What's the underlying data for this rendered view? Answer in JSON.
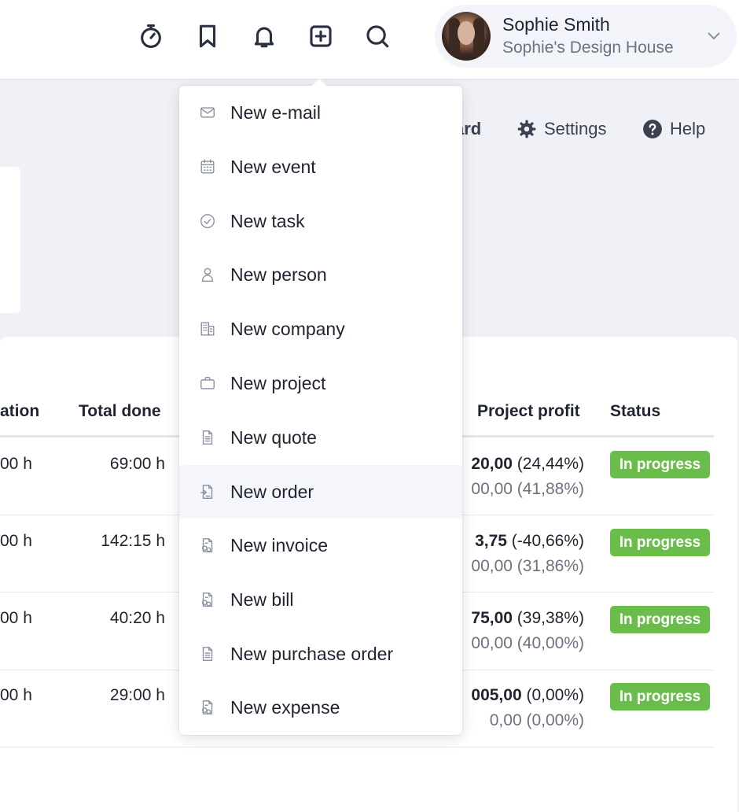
{
  "topbar": {
    "icons": [
      "stopwatch-icon",
      "bookmark-icon",
      "bell-icon",
      "plus-square-icon",
      "search-icon"
    ],
    "user": {
      "name": "Sophie Smith",
      "company": "Sophie's Design House"
    }
  },
  "subnav": {
    "partial_label": "ard",
    "settings_label": "Settings",
    "help_label": "Help"
  },
  "table": {
    "headers": {
      "duration_partial": "ation",
      "total_done": "Total done",
      "project_profit": "Project profit",
      "status": "Status"
    },
    "rows": [
      {
        "duration": "00 h",
        "total_done": "69:00 h",
        "profit_main": "20,00",
        "profit_main_pct": " (24,44%)",
        "profit_sub": "00,00 (41,88%)",
        "status": "In progress"
      },
      {
        "duration": "00 h",
        "total_done": "142:15 h",
        "profit_main": "3,75",
        "profit_main_pct": " (-40,66%)",
        "profit_sub": "00,00 (31,86%)",
        "status": "In progress"
      },
      {
        "duration": "00 h",
        "total_done": "40:20 h",
        "profit_main": "75,00",
        "profit_main_pct": " (39,38%)",
        "profit_sub": "00,00 (40,00%)",
        "status": "In progress"
      },
      {
        "duration": "00 h",
        "total_done": "29:00 h",
        "profit_main": "005,00",
        "profit_main_pct": " (0,00%)",
        "profit_sub": "0,00 (0,00%)",
        "status": "In progress"
      }
    ]
  },
  "dropdown": {
    "items": [
      {
        "label": "New e-mail",
        "icon": "mail-icon"
      },
      {
        "label": "New event",
        "icon": "calendar-icon"
      },
      {
        "label": "New task",
        "icon": "check-circle-icon"
      },
      {
        "label": "New person",
        "icon": "person-icon"
      },
      {
        "label": "New company",
        "icon": "building-icon"
      },
      {
        "label": "New project",
        "icon": "briefcase-icon"
      },
      {
        "label": "New quote",
        "icon": "document-icon"
      },
      {
        "label": "New order",
        "icon": "order-document-icon"
      },
      {
        "label": "New invoice",
        "icon": "invoice-document-icon"
      },
      {
        "label": "New bill",
        "icon": "bill-document-icon"
      },
      {
        "label": "New purchase order",
        "icon": "purchase-document-icon"
      },
      {
        "label": "New expense",
        "icon": "expense-document-icon"
      }
    ],
    "hovered_index": 7
  },
  "colors": {
    "badge_green": "#6bbd4b",
    "page_background": "#f0f1f6",
    "icon_gray": "#8a90a0"
  }
}
